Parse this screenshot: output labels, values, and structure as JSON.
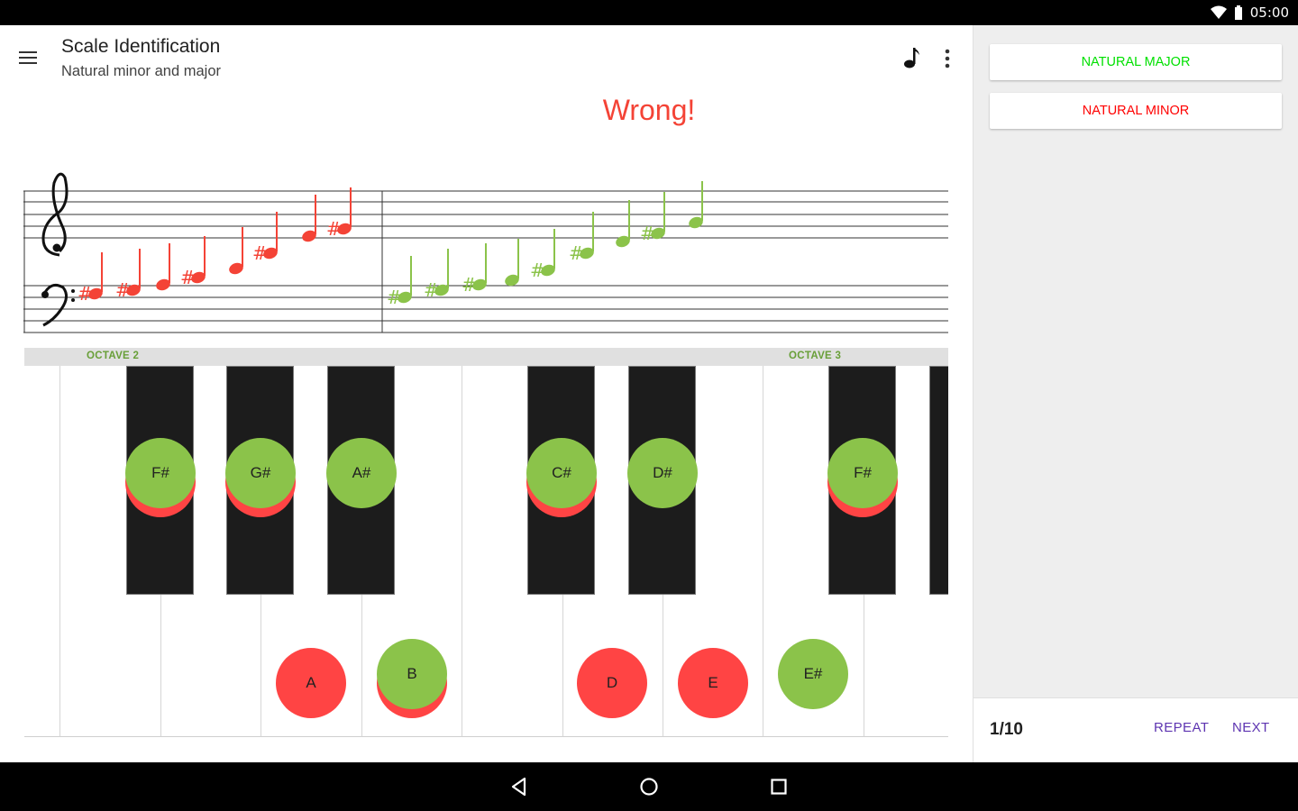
{
  "status": {
    "time": "05:00"
  },
  "app": {
    "title": "Scale Identification",
    "subtitle": "Natural minor and major"
  },
  "result": {
    "text": "Wrong!"
  },
  "staff": {
    "wrong_color": "#f44336",
    "right_color": "#8bc34a"
  },
  "keyboard": {
    "octaves": [
      {
        "label": "OCTAVE 2"
      },
      {
        "label": "OCTAVE 3"
      }
    ],
    "markers": [
      {
        "label": "F#"
      },
      {
        "label": "G#"
      },
      {
        "label": "A#"
      },
      {
        "label": "C#"
      },
      {
        "label": "D#"
      },
      {
        "label": "F#"
      },
      {
        "label": "A"
      },
      {
        "label": "B"
      },
      {
        "label": "D"
      },
      {
        "label": "E"
      },
      {
        "label": "E#"
      }
    ]
  },
  "choices": [
    {
      "label": "NATURAL MAJOR",
      "color": "#00e000"
    },
    {
      "label": "NATURAL MINOR",
      "color": "#ff0000"
    }
  ],
  "footer": {
    "progress": "1/10",
    "repeat": "REPEAT",
    "next": "NEXT"
  },
  "colors": {
    "accent": "#5e35b1",
    "wrong": "#ff4444",
    "right": "#8bc34a"
  }
}
